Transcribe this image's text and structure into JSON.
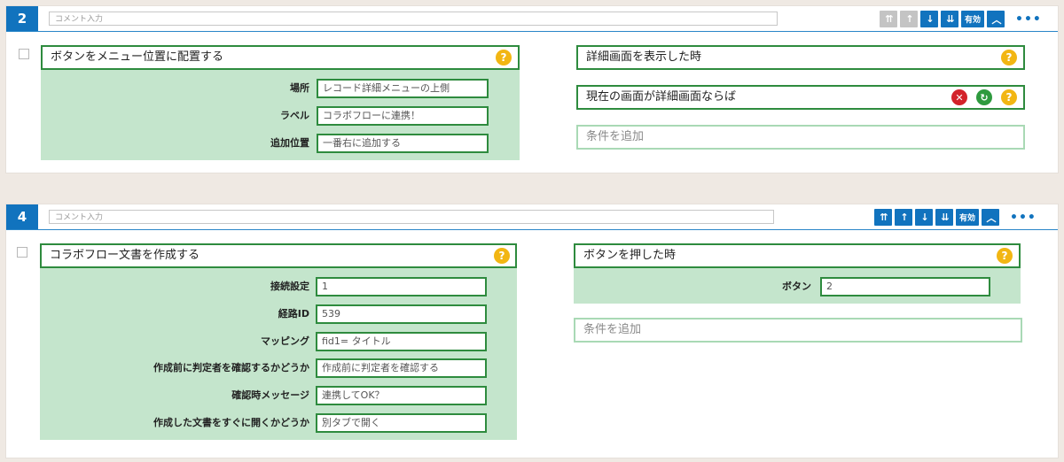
{
  "block1": {
    "number": "2",
    "comment_placeholder": "コメント入力",
    "toolbar": {
      "move_top": "⇈",
      "move_up": "↑",
      "move_down": "↓",
      "move_bottom": "⇊",
      "enabled_label": "有効",
      "collapse": "︿",
      "more": "•••"
    },
    "action": {
      "title": "ボタンをメニュー位置に配置する",
      "help": "?",
      "params": [
        {
          "label": "場所",
          "value": "レコード詳細メニューの上側"
        },
        {
          "label": "ラベル",
          "value": "コラボフローに連携！"
        },
        {
          "label": "追加位置",
          "value": "一番右に追加する"
        }
      ]
    },
    "trigger": {
      "title": "詳細画面を表示した時",
      "help": "?"
    },
    "condition": {
      "title": "現在の画面が詳細画面ならば",
      "delete": "✕",
      "refresh": "↻",
      "help": "?"
    },
    "add_condition": "条件を追加"
  },
  "block2": {
    "number": "4",
    "comment_placeholder": "コメント入力",
    "toolbar": {
      "move_top": "⇈",
      "move_up": "↑",
      "move_down": "↓",
      "move_bottom": "⇊",
      "enabled_label": "有効",
      "collapse": "︿",
      "more": "•••"
    },
    "action": {
      "title": "コラボフロー文書を作成する",
      "help": "?",
      "params": [
        {
          "label": "接続設定",
          "value": "1"
        },
        {
          "label": "経路ID",
          "value": "539"
        },
        {
          "label": "マッピング",
          "value": "fid1= タイトル"
        },
        {
          "label": "作成前に判定者を確認するかどうか",
          "value": "作成前に判定者を確認する"
        },
        {
          "label": "確認時メッセージ",
          "value": "連携してOK？"
        },
        {
          "label": "作成した文書をすぐに開くかどうか",
          "value": "別タブで開く"
        }
      ]
    },
    "trigger": {
      "title": "ボタンを押した時",
      "help": "?",
      "params": [
        {
          "label": "ボタン",
          "value": "2"
        }
      ]
    },
    "add_condition": "条件を追加"
  },
  "colors": {
    "accent_blue": "#1173be",
    "green_border": "#2e8b3e",
    "param_bg": "#c4e5cc",
    "help_yellow": "#f2b613",
    "delete_red": "#d3222a",
    "refresh_green": "#2e9a3e"
  }
}
